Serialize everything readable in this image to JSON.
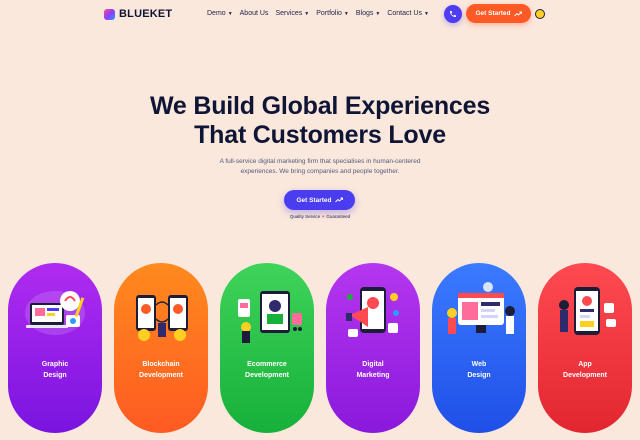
{
  "brand": {
    "name": "BLUEKET"
  },
  "nav": [
    {
      "label": "Demo",
      "has_dropdown": true
    },
    {
      "label": "About Us",
      "has_dropdown": false
    },
    {
      "label": "Services",
      "has_dropdown": true
    },
    {
      "label": "Portfolio",
      "has_dropdown": true
    },
    {
      "label": "Blogs",
      "has_dropdown": true
    },
    {
      "label": "Contact Us",
      "has_dropdown": true
    }
  ],
  "header": {
    "cta_label": "Get Started"
  },
  "hero": {
    "title_line1": "We Build Global Experiences",
    "title_line2": "That Customers Love",
    "subtitle_line1": "A full-service digital marketing firm that specialises in human-centered",
    "subtitle_line2": "experiences. We bring companies and people together.",
    "cta_label": "Get Started",
    "guarantee_left": "Quality Service",
    "guarantee_right": "Guaranteed"
  },
  "services": [
    {
      "line1": "Graphic",
      "line2": "Design",
      "color_top": "#b02bf0",
      "color_bottom": "#7a14e0"
    },
    {
      "line1": "Blockchain",
      "line2": "Development",
      "color_top": "#ff8a1e",
      "color_bottom": "#ff5a22"
    },
    {
      "line1": "Ecommerce",
      "line2": "Development",
      "color_top": "#3fd35a",
      "color_bottom": "#16b03a"
    },
    {
      "line1": "Digital",
      "line2": "Marketing",
      "color_top": "#b536ef",
      "color_bottom": "#8a19dc"
    },
    {
      "line1": "Web",
      "line2": "Design",
      "color_top": "#3b7bff",
      "color_bottom": "#1f4fe8"
    },
    {
      "line1": "App",
      "line2": "Development",
      "color_top": "#ff4a52",
      "color_bottom": "#e2262f"
    }
  ],
  "colors": {
    "background": "#fbe8dd",
    "primary": "#4a3cef",
    "accent": "#ff5a26",
    "heading": "#0f1535"
  },
  "icons": [
    "phone-icon",
    "arrow-trend-icon",
    "theme-toggle-icon",
    "seal-icon"
  ]
}
